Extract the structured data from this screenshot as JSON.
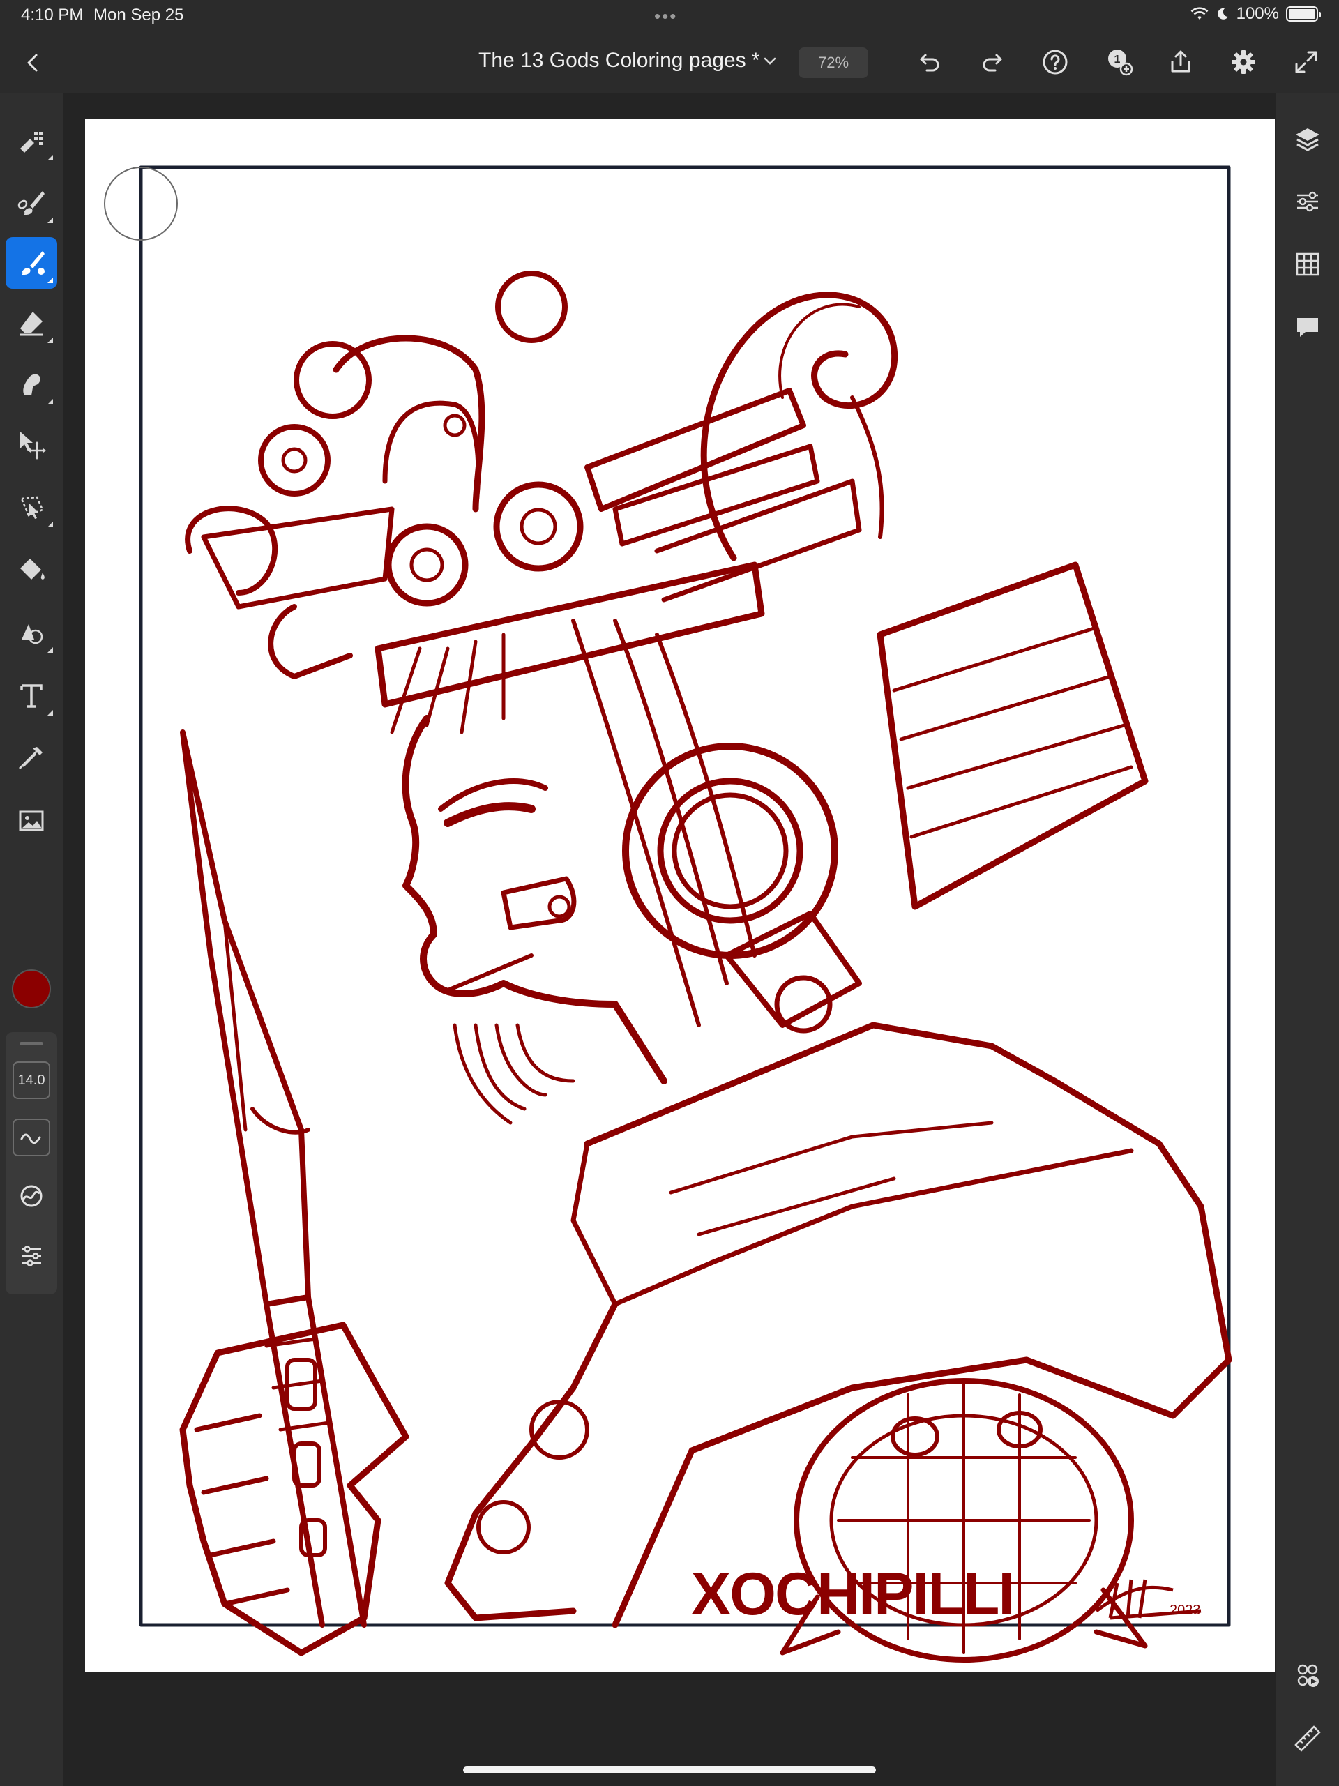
{
  "status_bar": {
    "time": "4:10 PM",
    "date": "Mon Sep 25",
    "battery": "100%"
  },
  "header": {
    "title": "The 13 Gods Coloring pages *",
    "zoom": "72%"
  },
  "brush": {
    "size": "14.0",
    "color": "#8b0000"
  },
  "artwork": {
    "caption": "XOCHIPILLI",
    "signature_year": "2023"
  },
  "left_tools": [
    "pixel-brush",
    "paint-brush",
    "vector-brush",
    "eraser",
    "smudge",
    "move",
    "lasso-select",
    "fill",
    "liquify",
    "text",
    "eyedropper",
    "image-import"
  ],
  "right_tools": [
    "layers",
    "layer-properties",
    "grid",
    "comments",
    "share-live",
    "ruler"
  ],
  "colors": {
    "accent": "#1473e6",
    "ink": "#8b0000",
    "chrome": "#2b2b2b"
  }
}
